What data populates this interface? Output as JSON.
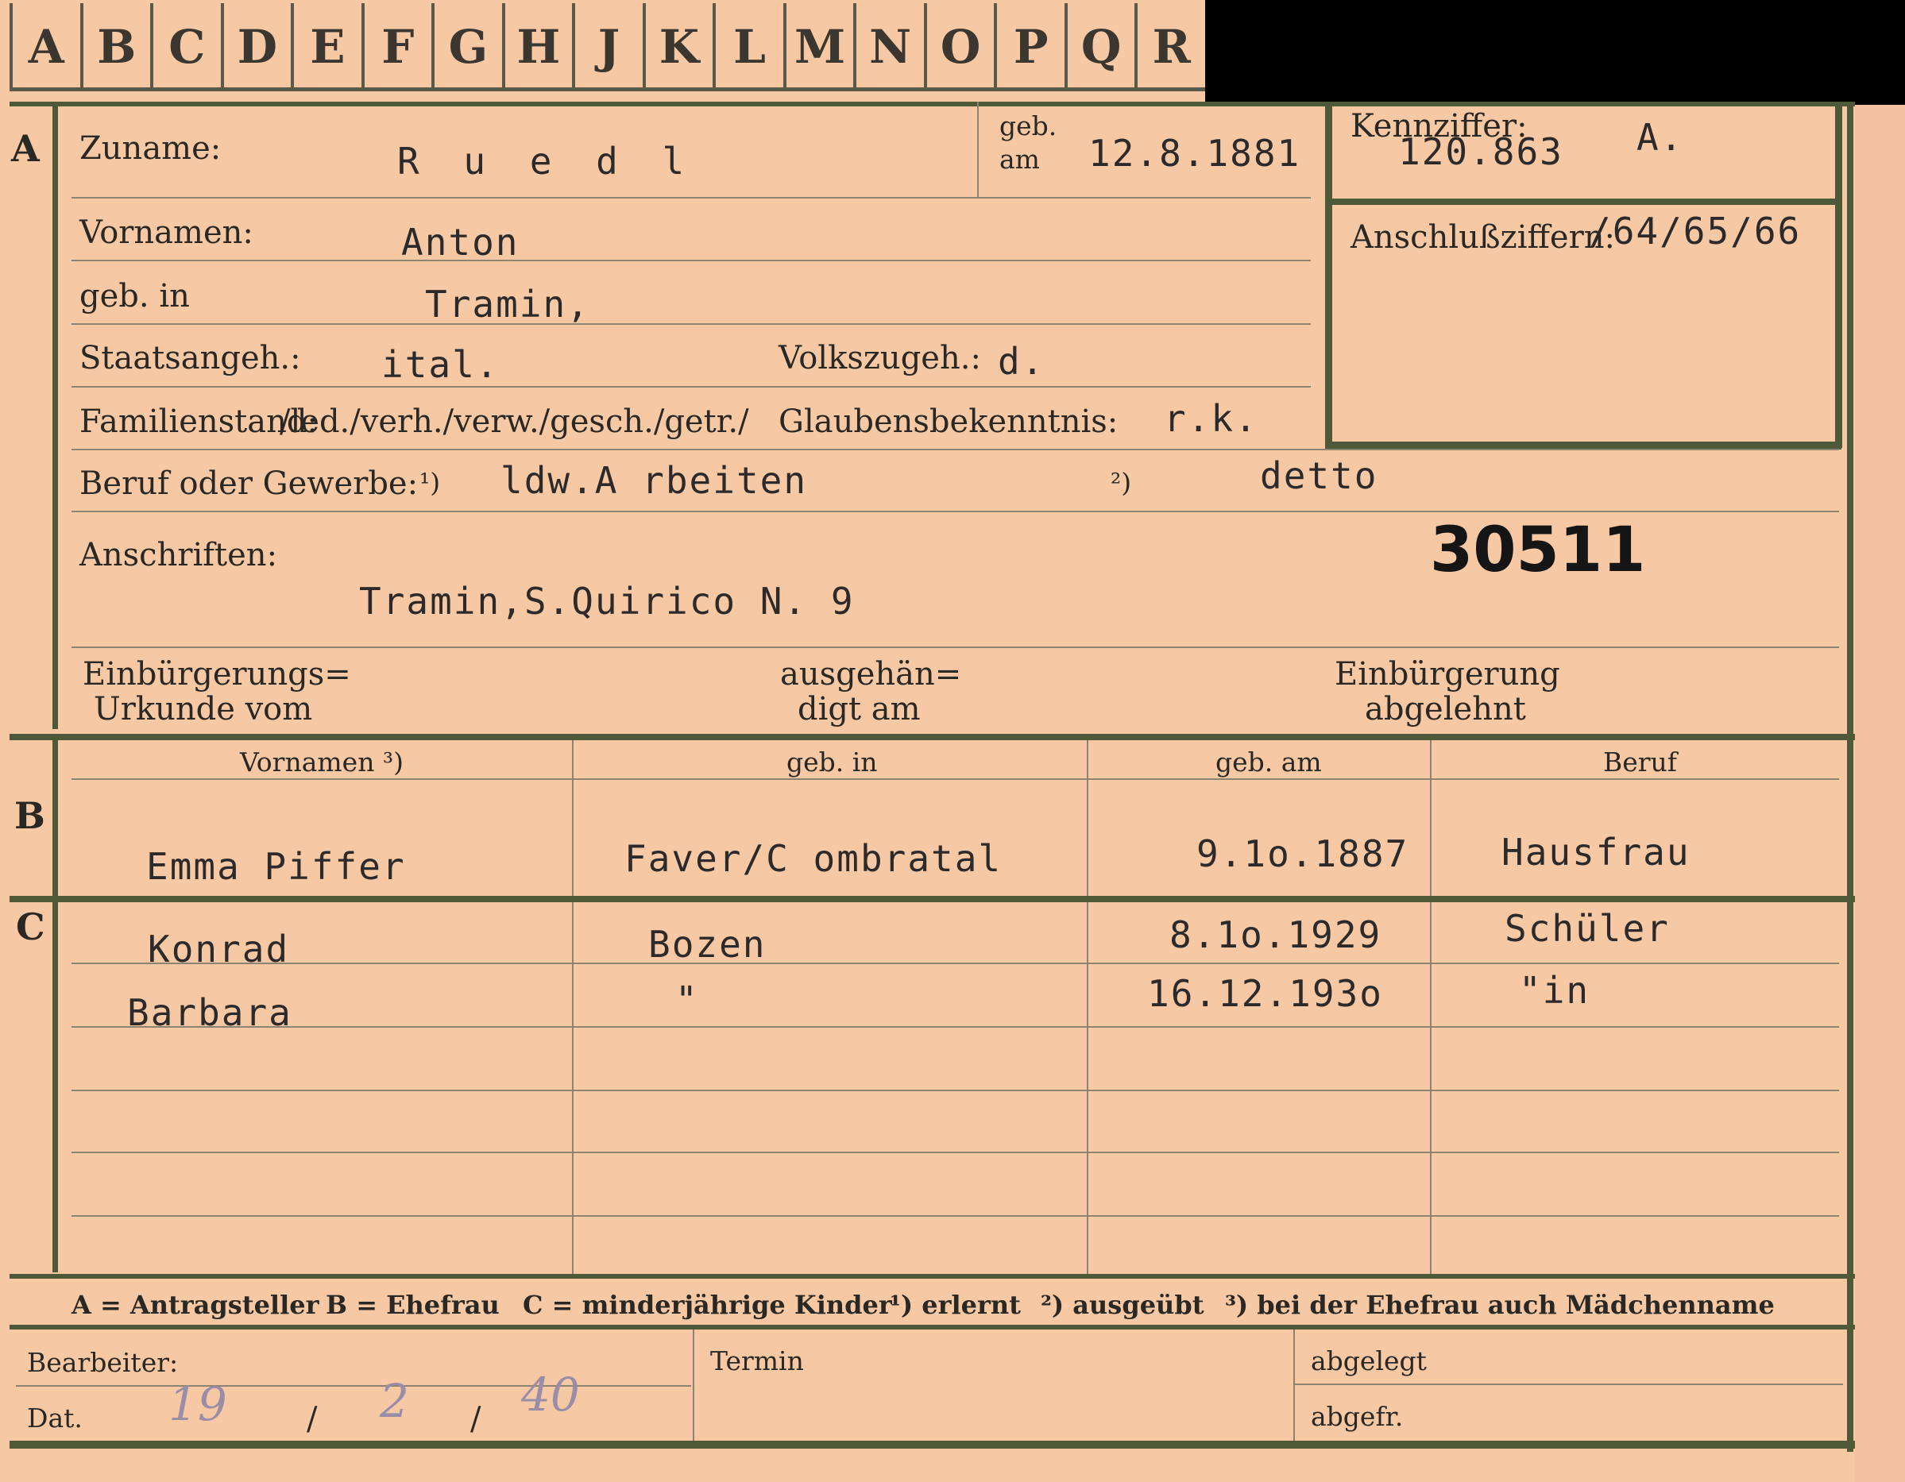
{
  "tabs": [
    "A",
    "B",
    "C",
    "D",
    "E",
    "F",
    "G",
    "H",
    "J",
    "K",
    "L",
    "M",
    "N",
    "O",
    "P",
    "Q",
    "R"
  ],
  "section_a": {
    "marker": "A",
    "zuname_label": "Zuname:",
    "zuname_value": "R u e d l",
    "geb_am_label": "geb. am",
    "geb_am_value": "12.8.1881",
    "kennziffer_label": "Kennziffer:",
    "kennziffer_value": "120.863",
    "kennziffer_letter": "A.",
    "anschluss_label": "Anschlußziffern:",
    "anschluss_value": "/64/65/66",
    "vornamen_label": "Vornamen:",
    "vornamen_value": "Anton",
    "geb_in_label": "geb. in",
    "geb_in_value": "Tramin,",
    "staatsangeh_label": "Staatsangeh.:",
    "staatsangeh_value": "ital.",
    "volkszugeh_label": "Volkszugeh.:",
    "volkszugeh_value": "d.",
    "familienstand_label": "Familienstand:",
    "familienstand_options": "/led./verh./verw./gesch./getr./",
    "glauben_label": "Glaubensbekenntnis:",
    "glauben_value": "r.k.",
    "beruf_label": "Beruf oder Gewerbe:",
    "beruf_mark1": "¹)",
    "beruf_value1": "ldw.A rbeiten",
    "beruf_mark2": "²)",
    "beruf_value2": "detto",
    "anschriften_label": "Anschriften:",
    "anschriften_value": "Tramin,S.Quirico N. 9",
    "stamp_number": "30511",
    "einb_urkunde_label_1": "Einbürgerungs=",
    "einb_urkunde_label_2": "Urkunde vom",
    "ausgeh_label_1": "ausgehän=",
    "ausgeh_label_2": "digt am",
    "einb_abgelehnt_label_1": "Einbürgerung",
    "einb_abgelehnt_label_2": "abgelehnt"
  },
  "section_b": {
    "marker": "B",
    "headers": [
      "Vornamen ³)",
      "geb. in",
      "geb. am",
      "Beruf"
    ],
    "row": [
      "Emma Piffer",
      "Faver/C ombratal",
      "9.1o.1887",
      "Hausfrau"
    ]
  },
  "section_c": {
    "marker": "C",
    "rows": [
      [
        "Konrad",
        "Bozen",
        "8.1o.1929",
        "Schüler"
      ],
      [
        "Barbara",
        "\"",
        "16.12.193o",
        "\"in"
      ]
    ]
  },
  "legend": {
    "a": "A = Antragsteller",
    "b": "B = Ehefrau",
    "c": "C = minderjährige Kinder",
    "n1": "¹) erlernt",
    "n2": "²) ausgeübt",
    "n3": "³) bei der Ehefrau auch Mädchenname"
  },
  "footer": {
    "bearbeiter_label": "Bearbeiter:",
    "dat_label": "Dat.",
    "dat_day": "19",
    "dat_month": "2",
    "dat_year": "40",
    "termin_label": "Termin",
    "abgelegt_label": "abgelegt",
    "abgefr_label": "abgefr."
  }
}
